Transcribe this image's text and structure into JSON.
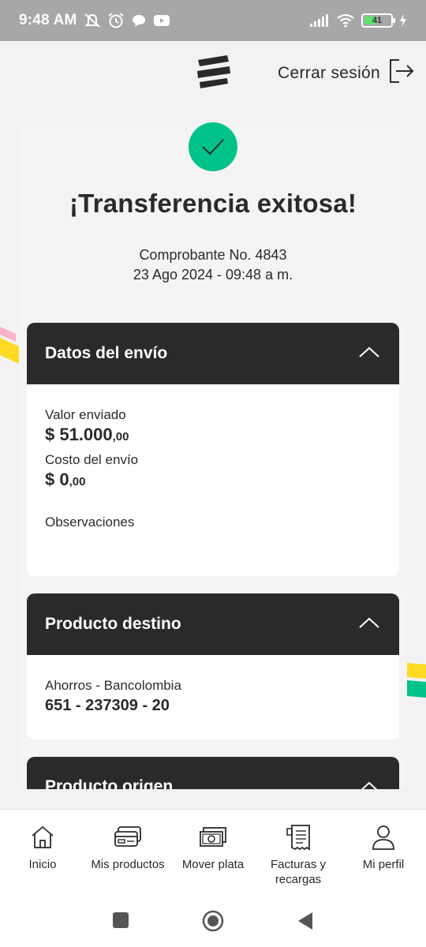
{
  "status_bar": {
    "time": "9:48 AM",
    "battery": "41"
  },
  "header": {
    "logout_label": "Cerrar sesión"
  },
  "receipt": {
    "title": "¡Transferencia exitosa!",
    "number": "Comprobante No. 4843",
    "date": "23 Ago 2024 - 09:48 a m."
  },
  "sections": {
    "shipping": {
      "title": "Datos del envío",
      "amount_label": "Valor enviado",
      "amount_main": "$ 51.000",
      "amount_cents": ",00",
      "fee_label": "Costo del envío",
      "fee_main": "$ 0",
      "fee_cents": ",00",
      "notes_label": "Observaciones"
    },
    "destination": {
      "title": "Producto destino",
      "account_type": "Ahorros - Bancolombia",
      "account_number": "651 - 237309 - 20"
    },
    "origin": {
      "title": "Producto origen"
    }
  },
  "bottom_nav": [
    {
      "label": "Inicio",
      "icon": "home-icon"
    },
    {
      "label": "Mis productos",
      "icon": "cards-icon"
    },
    {
      "label": "Mover plata",
      "icon": "money-icon"
    },
    {
      "label": "Facturas y recargas",
      "icon": "bill-icon"
    },
    {
      "label": "Mi perfil",
      "icon": "user-icon"
    }
  ],
  "colors": {
    "success": "#00c389",
    "dark": "#2c2a29",
    "accent_yellow": "#fdda24",
    "accent_pink": "#f8b3c8"
  }
}
